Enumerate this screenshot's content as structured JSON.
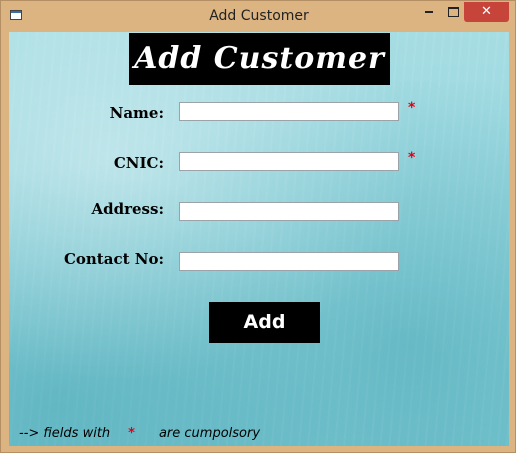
{
  "window": {
    "title": "Add Customer",
    "minimize_icon": "minimize-icon",
    "maximize_icon": "maximize-icon",
    "close_icon": "close-icon",
    "close_glyph": "✕"
  },
  "form": {
    "heading": "Add Customer",
    "fields": [
      {
        "label": "Name:",
        "value": "",
        "required_mark": "*"
      },
      {
        "label": "CNIC:",
        "value": "",
        "required_mark": "*"
      },
      {
        "label": "Address:",
        "value": ""
      },
      {
        "label": "Contact No:",
        "value": ""
      }
    ],
    "add_button_label": "Add"
  },
  "footer": {
    "prefix": "--> fields with",
    "required_mark": "*",
    "suffix": "are cumpolsory"
  },
  "colors": {
    "background": "#8fd1da",
    "required": "#e0001b",
    "heading_bg": "#000000",
    "close_button": "#c7443a"
  }
}
